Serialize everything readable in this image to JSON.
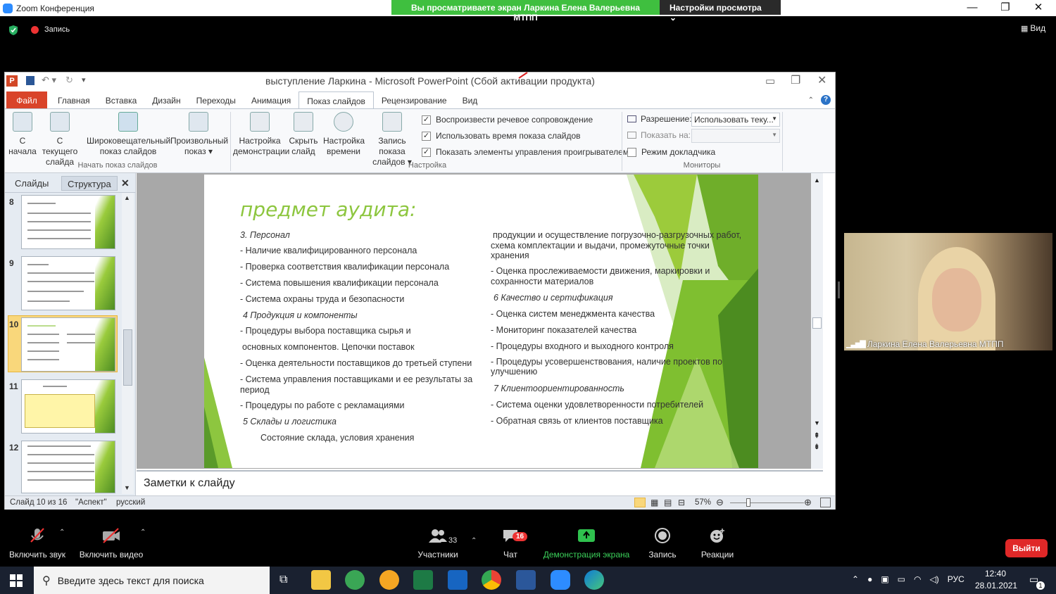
{
  "zoom": {
    "title": "Zoom Конференция",
    "viewing_banner": "Вы просматриваете экран Ларкина Елена Валерьевна МТПП",
    "view_settings": "Настройки просмотра",
    "recording": "Запись",
    "view_button": "Вид",
    "participant_name": "Ларкина Елена Валерьевна МТПП",
    "exit_label": "Выйти",
    "toolbar": {
      "mic": "Включить звук",
      "video": "Включить видео",
      "participants": "Участники",
      "participants_count": "33",
      "chat": "Чат",
      "chat_badge": "16",
      "share": "Демонстрация экрана",
      "record": "Запись",
      "reactions": "Реакции"
    }
  },
  "ppt": {
    "title": "выступление Ларкина - Microsoft PowerPoint (Сбой активации продукта)",
    "tabs": [
      "Файл",
      "Главная",
      "Вставка",
      "Дизайн",
      "Переходы",
      "Анимация",
      "Показ слайдов",
      "Рецензирование",
      "Вид"
    ],
    "ribbon": {
      "from_start": [
        "С",
        "начала"
      ],
      "from_current": [
        "С текущего",
        "слайда"
      ],
      "broadcast": [
        "Широковещательный",
        "показ слайдов"
      ],
      "custom": [
        "Произвольный",
        "показ ▾"
      ],
      "group_start": "Начать показ слайдов",
      "setup": [
        "Настройка",
        "демонстрации"
      ],
      "hide": [
        "Скрыть",
        "слайд"
      ],
      "rehearse": [
        "Настройка",
        "времени"
      ],
      "record_show": [
        "Запись показа",
        "слайдов ▾"
      ],
      "chk_narration": "Воспроизвести речевое сопровождение",
      "chk_timings": "Использовать время показа слайдов",
      "chk_controls": "Показать элементы управления проигрывателем",
      "group_setup": "Настройка",
      "resolution_label": "Разрешение:",
      "resolution_value": "Использовать теку...",
      "show_on_label": "Показать на:",
      "presenter_view": "Режим докладчика",
      "group_monitors": "Мониторы"
    },
    "panel_tabs": [
      "Слайды",
      "Структура"
    ],
    "thumb_numbers": [
      "8",
      "9",
      "10",
      "11",
      "12"
    ],
    "notes_placeholder": "Заметки к слайду",
    "status": {
      "slide": "Слайд 10 из 16",
      "theme": "\"Аспект\"",
      "lang": "русский",
      "zoom": "57%"
    },
    "slide": {
      "title": "предмет аудита:",
      "left": [
        "3. Персонал",
        "- Наличие квалифицированного персонала",
        "- Проверка соответствия квалификации персонала",
        "- Система повышения квалификации персонала",
        "- Система охраны труда и безопасности",
        "4 Продукция и компоненты",
        "- Процедуры выбора поставщика сырья и",
        "основных компонентов. Цепочки поставок",
        "- Оценка деятельности поставщиков до третьей ступени",
        "- Система управления поставщиками и ее результаты за",
        "период",
        "- Процедуры по работе с рекламациями",
        "5 Склады и логистика",
        "Состояние склада, условия хранения"
      ],
      "right": [
        "продукции и осуществление погрузочно-разгрузочных работ,",
        "схема комплектации и выдачи, промежуточные точки",
        "хранения",
        "- Оценка прослеживаемости движения, маркировки и",
        "сохранности материалов",
        "6 Качество и сертификация",
        "- Оценка систем менеджмента качества",
        "- Мониторинг показателей качества",
        "- Процедуры входного и выходного контроля",
        "- Процедуры усовершенствования, наличие проектов по",
        "улучшению",
        "7 Клиентоориентированность",
        "- Система оценки удовлетворенности потребителей",
        "- Обратная связь от клиентов поставщика"
      ]
    }
  },
  "taskbar": {
    "search": "Введите здесь текст для поиска",
    "time": "12:40",
    "date": "28.01.2021",
    "lang": "РУС",
    "notif": "1"
  }
}
